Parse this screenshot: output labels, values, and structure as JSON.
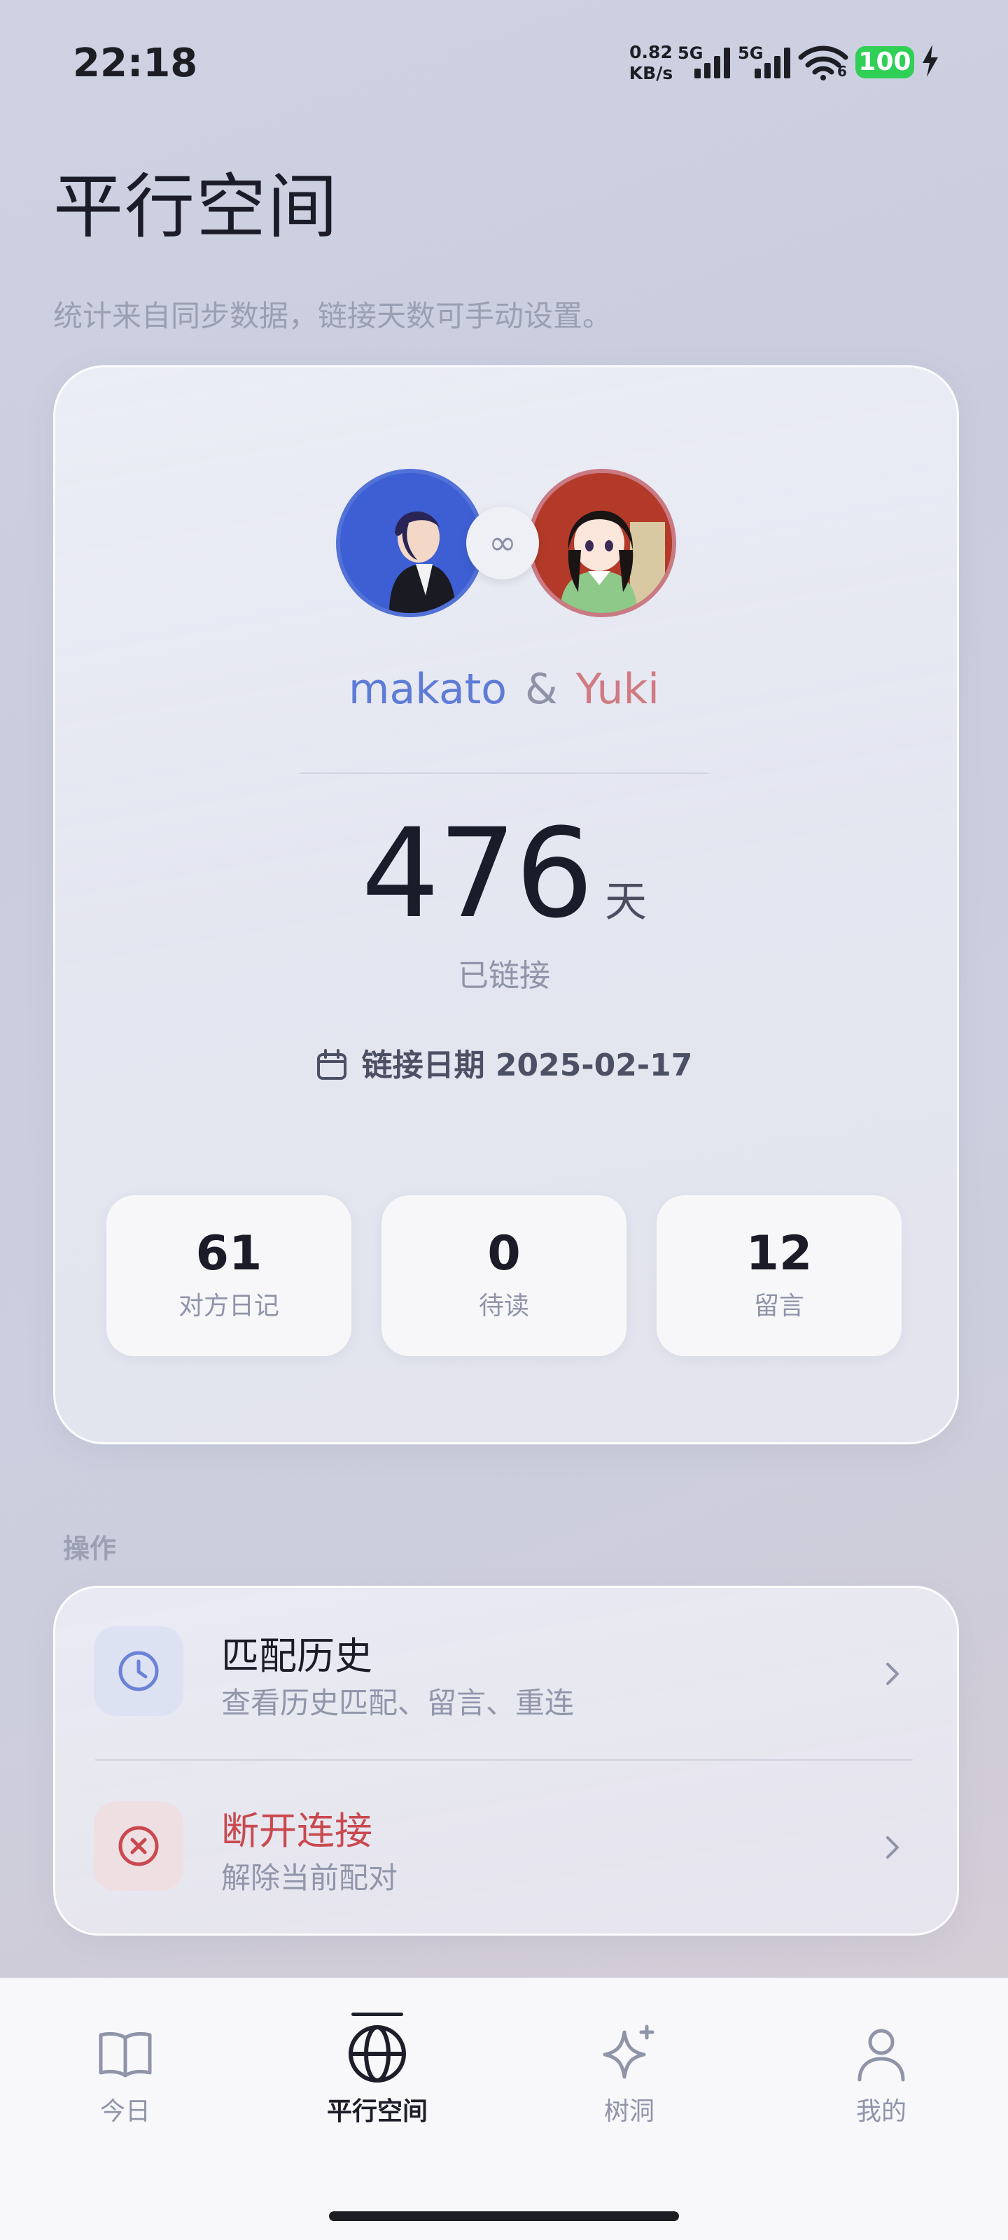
{
  "status_bar": {
    "time": "22:18",
    "net_speed_value": "0.82",
    "net_speed_unit": "KB/s",
    "network_1": "5G",
    "network_2": "5G",
    "wifi_badge": "6",
    "battery": "100"
  },
  "header": {
    "title": "平行空间",
    "subtitle": "统计来自同步数据，链接天数可手动设置。"
  },
  "connection_card": {
    "user_a": "makato",
    "separator": "&",
    "user_b": "Yuki",
    "link_symbol": "∞",
    "days_value": "476",
    "days_unit": "天",
    "days_label": "已链接",
    "link_date_label": "链接日期 2025-02-17",
    "stats": [
      {
        "value": "61",
        "label": "对方日记"
      },
      {
        "value": "0",
        "label": "待读"
      },
      {
        "value": "12",
        "label": "留言"
      }
    ]
  },
  "operations": {
    "section_label": "操作",
    "items": [
      {
        "title": "匹配历史",
        "subtitle": "查看历史匹配、留言、重连",
        "icon": "clock-icon"
      },
      {
        "title": "断开连接",
        "subtitle": "解除当前配对",
        "icon": "close-circle-icon"
      }
    ]
  },
  "bottom_nav": {
    "items": [
      {
        "label": "今日",
        "icon": "book-icon"
      },
      {
        "label": "平行空间",
        "icon": "globe-icon",
        "active": true
      },
      {
        "label": "树洞",
        "icon": "sparkle-icon"
      },
      {
        "label": "我的",
        "icon": "person-icon"
      }
    ]
  },
  "colors": {
    "user_a": "#5e7bd6",
    "user_b": "#d07a82",
    "danger": "#c9494f"
  }
}
